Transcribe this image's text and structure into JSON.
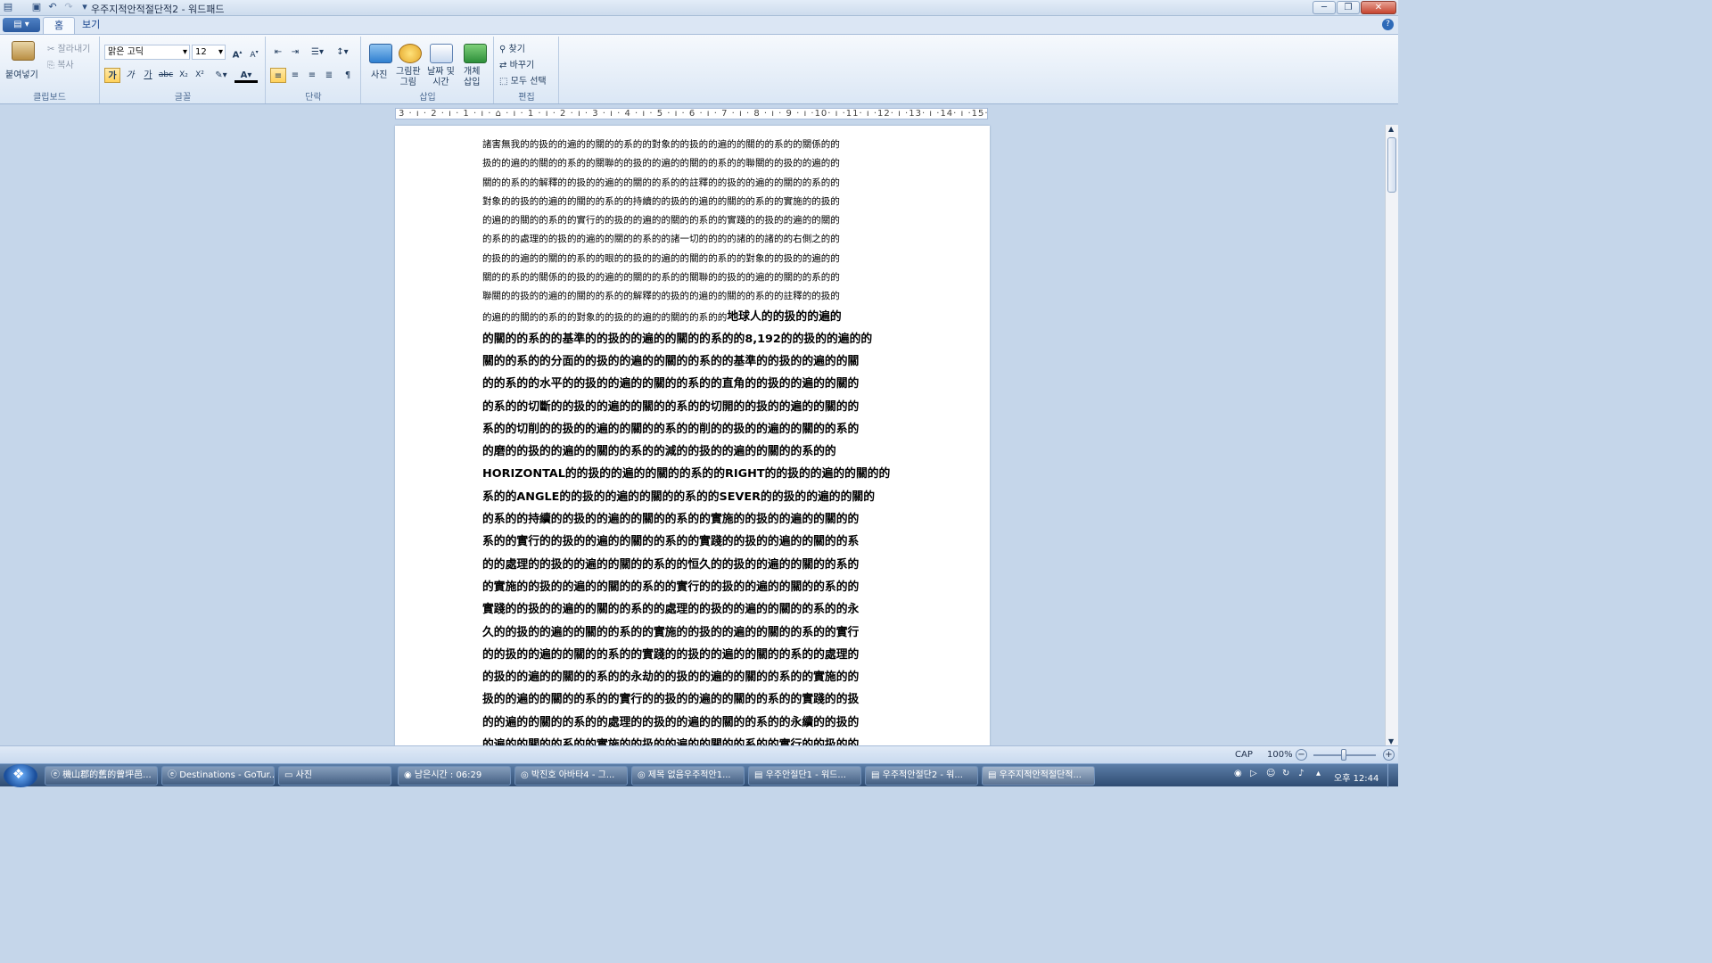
{
  "window": {
    "title": "우주지적안적절단적2 - 워드패드"
  },
  "tabs": [
    "홈",
    "보기"
  ],
  "ribbon": {
    "clipboard": {
      "paste": "붙여넣기",
      "cut": "잘라내기",
      "copy": "복사",
      "label": "클립보드"
    },
    "font": {
      "family": "맑은 고딕",
      "size": "12",
      "label": "글꼴",
      "tools": [
        "가",
        "가",
        "가",
        "abc",
        "X₂",
        "X²",
        "A"
      ]
    },
    "paragraph": {
      "label": "단락"
    },
    "insert": {
      "picture": "사진",
      "paint": "그림판\n그림",
      "datetime": "날짜 및\n시간",
      "object": "개체\n삽입",
      "label": "삽입"
    },
    "editing": {
      "find": "찾기",
      "replace": "바꾸기",
      "select_all": "모두 선택",
      "label": "편집"
    }
  },
  "ruler": "3 · ı · 2 · ı · 1 · ı · ⌂ · ı · 1 · ı · 2 · ı · 3 · ı · 4 · ı · 5 · ı · 6 · ı · 7 · ı · 8 · ı · 9 · ı ·10· ı ·11· ı ·12· ı ·13· ı ·14· ı ·15· ı ·16· ı ·17· ı ·18·",
  "document": {
    "small_lines": [
      "諸害無我的的扱的的遍的的關的的系的的對象的的扱的的遍的的關的的系的的關係的的",
      "扱的的遍的的關的的系的的關聯的的扱的的遍的的關的的系的的聯關的的扱的的遍的的",
      "關的的系的的解釋的的扱的的遍的的關的的系的的註釋的的扱的的遍的的關的的系的的",
      "對象的的扱的的遍的的關的的系的的持續的的扱的的遍的的關的的系的的實施的的扱的",
      "的遍的的關的的系的的實行的的扱的的遍的的關的的系的的實踐的的扱的的遍的的關的",
      "的系的的處理的的扱的的遍的的關的的系的的諸一切的的的的諸的的諸的的右側之的的",
      "的扱的的遍的的關的的系的的眼的的扱的的遍的的關的的系的的對象的的扱的的遍的的",
      "關的的系的的關係的的扱的的遍的的關的的系的的關聯的的扱的的遍的的關的的系的的",
      "聯關的的扱的的遍的的關的的系的的解釋的的扱的的遍的的關的的系的的註釋的的扱的"
    ],
    "mixed_line_small": "的遍的的關的的系的的對象的的扱的的遍的的關的的系的的",
    "mixed_line_big": "地球人的的扱的的遍的",
    "big_lines": [
      "的關的的系的的基準的的扱的的遍的的關的的系的的8,192的的扱的的遍的的",
      "關的的系的的分面的的扱的的遍的的關的的系的的基準的的扱的的遍的的關",
      "的的系的的水平的的扱的的遍的的關的的系的的直角的的扱的的遍的的關的",
      "的系的的切斷的的扱的的遍的的關的的系的的切開的的扱的的遍的的關的的",
      "系的的切削的的扱的的遍的的關的的系的的削的的扱的的遍的的關的的系的",
      "的磨的的扱的的遍的的關的的系的的減的的扱的的遍的的關的的系的的",
      "HORIZONTAL的的扱的的遍的的關的的系的的RIGHT的的扱的的遍的的關的的",
      "系的的ANGLE的的扱的的遍的的關的的系的的SEVER的的扱的的遍的的關的",
      "的系的的持續的的扱的的遍的的關的的系的的實施的的扱的的遍的的關的的",
      "系的的實行的的扱的的遍的的關的的系的的實踐的的扱的的遍的的關的的系",
      "的的處理的的扱的的遍的的關的的系的的恒久的的扱的的遍的的關的的系的",
      "的實施的的扱的的遍的的關的的系的的實行的的扱的的遍的的關的的系的的",
      "實踐的的扱的的遍的的關的的系的的處理的的扱的的遍的的關的的系的的永",
      "久的的扱的的遍的的關的的系的的實施的的扱的的遍的的關的的系的的實行",
      "的的扱的的遍的的關的的系的的實踐的的扱的的遍的的關的的系的的處理的",
      "的扱的的遍的的關的的系的的永劫的的扱的的遍的的關的的系的的實施的的",
      "扱的的遍的的關的的系的的實行的的扱的的遍的的關的的系的的實踐的的扱",
      "的的遍的的關的的系的的處理的的扱的的遍的的關的的系的的永續的的扱的",
      "的遍的的關的的系的的實施的的扱的的遍的的關的的系的的實行的的扱的的"
    ]
  },
  "status": {
    "caps": "CAP",
    "zoom": "100%"
  },
  "taskbar": {
    "items": [
      "機山郡的舊的曾坪邑...",
      "Destinations - GoTur...",
      "사진",
      "남은시간 : 06:29",
      "박진호 아바타4 - 그...",
      "제목 없음우주적안1...",
      "우주안절단1 - 워드...",
      "우주적안절단2 - 워...",
      "우주지적안적절단적..."
    ],
    "clock": "오후 12:44"
  }
}
